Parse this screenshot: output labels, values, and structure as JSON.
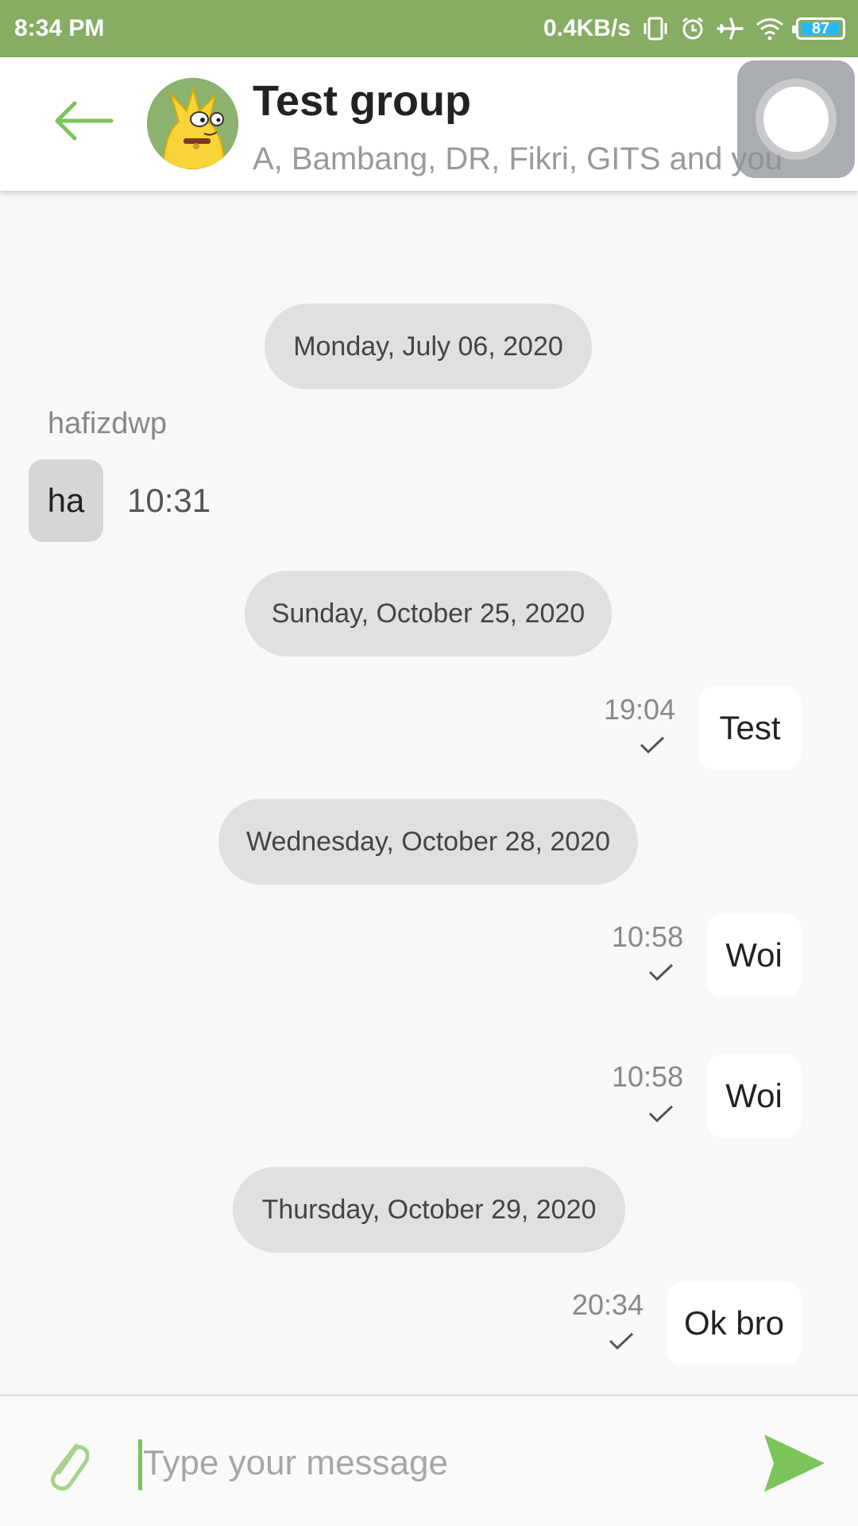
{
  "status_bar": {
    "time": "8:34 PM",
    "net_speed": "0.4KB/s",
    "battery": "87",
    "icons": [
      "vibrate-icon",
      "alarm-icon",
      "airplane-icon",
      "wifi-icon",
      "battery-icon"
    ],
    "bg_color": "#86ad63"
  },
  "header": {
    "title": "Test group",
    "members": "A, Bambang, DR, Fikri, GITS and you",
    "back_icon": "back-arrow-icon",
    "accent_color": "#7cc35a"
  },
  "messages": {
    "date1": "Monday, July 06, 2020",
    "m1_sender": "hafizdwp",
    "m1_text": "ha",
    "m1_time": "10:31",
    "date2": "Sunday, October 25, 2020",
    "m2_text": "Test",
    "m2_time": "19:04",
    "date3": "Wednesday, October 28, 2020",
    "m3_text": "Woi",
    "m3_time": "10:58",
    "m4_text": "Woi",
    "m4_time": "10:58",
    "date4": "Thursday, October 29, 2020",
    "m5_text": "Ok bro",
    "m5_time": "20:34"
  },
  "input": {
    "placeholder": "Type your message",
    "attach_icon": "paperclip-icon",
    "send_icon": "send-icon"
  }
}
